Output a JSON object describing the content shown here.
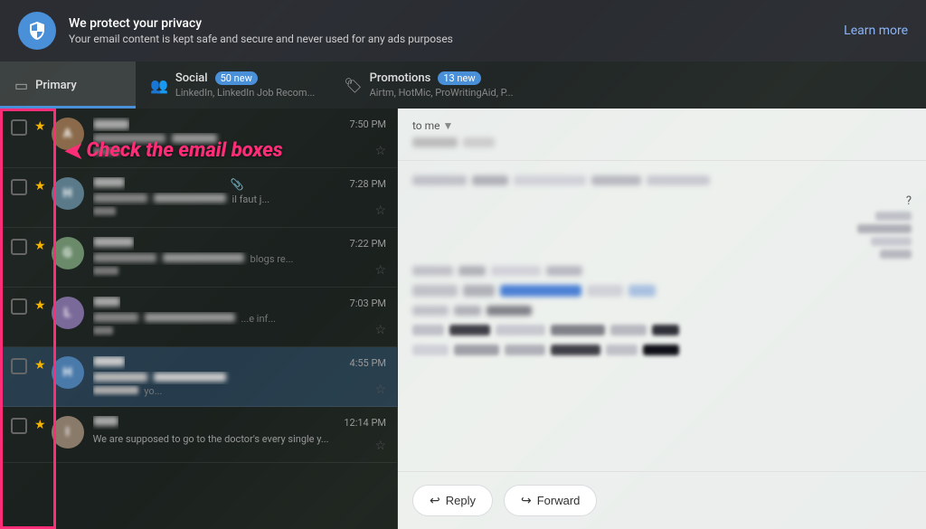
{
  "privacy": {
    "title": "We protect your privacy",
    "subtitle": "Your email content is kept safe and secure and never used for any ads purposes",
    "learn_more": "Learn more"
  },
  "tabs": [
    {
      "id": "primary",
      "label": "Primary",
      "subtitle": "",
      "badge": null,
      "active": true,
      "icon": "inbox"
    },
    {
      "id": "social",
      "label": "Social",
      "subtitle": "LinkedIn, LinkedIn Job Recom...",
      "badge": "50 new",
      "active": false,
      "icon": "people"
    },
    {
      "id": "promotions",
      "label": "Promotions",
      "subtitle": "Airtm, HotMic, ProWritingAid, P...",
      "badge": "13 new",
      "active": false,
      "icon": "tag"
    }
  ],
  "annotation": {
    "text": "Check the email boxes"
  },
  "emails": [
    {
      "id": 1,
      "sender": "Am",
      "time": "7:50 PM",
      "subject": "...co...",
      "preview": "Vie...",
      "starred": true,
      "selected": false,
      "avatar_color": "#888"
    },
    {
      "id": 2,
      "sender": "Hu",
      "time": "7:28 PM",
      "subject": "il faut j...",
      "preview": "Bo...",
      "starred": true,
      "selected": false,
      "has_attachment": true,
      "avatar_color": "#777"
    },
    {
      "id": 3,
      "sender": "Gue",
      "time": "7:22 PM",
      "subject": "blogs re...",
      "preview": "He...",
      "starred": true,
      "selected": false,
      "avatar_color": "#666"
    },
    {
      "id": 4,
      "sender": "Lo",
      "time": "7:03 PM",
      "subject": "...e inf...",
      "preview": "De...",
      "starred": true,
      "selected": false,
      "avatar_color": "#555"
    },
    {
      "id": 5,
      "sender": "He",
      "time": "4:55 PM",
      "subject": "yo...",
      "preview": "He lo...",
      "starred": true,
      "selected": true,
      "avatar_color": "#444"
    },
    {
      "id": 6,
      "sender": "It's",
      "time": "12:14 PM",
      "subject": "",
      "preview": "We are supposed to go to the doctor's every single y...",
      "starred": true,
      "selected": false,
      "avatar_color": "#666"
    }
  ],
  "reading_pane": {
    "to_label": "to me",
    "reply_label": "Reply",
    "forward_label": "Forward"
  }
}
